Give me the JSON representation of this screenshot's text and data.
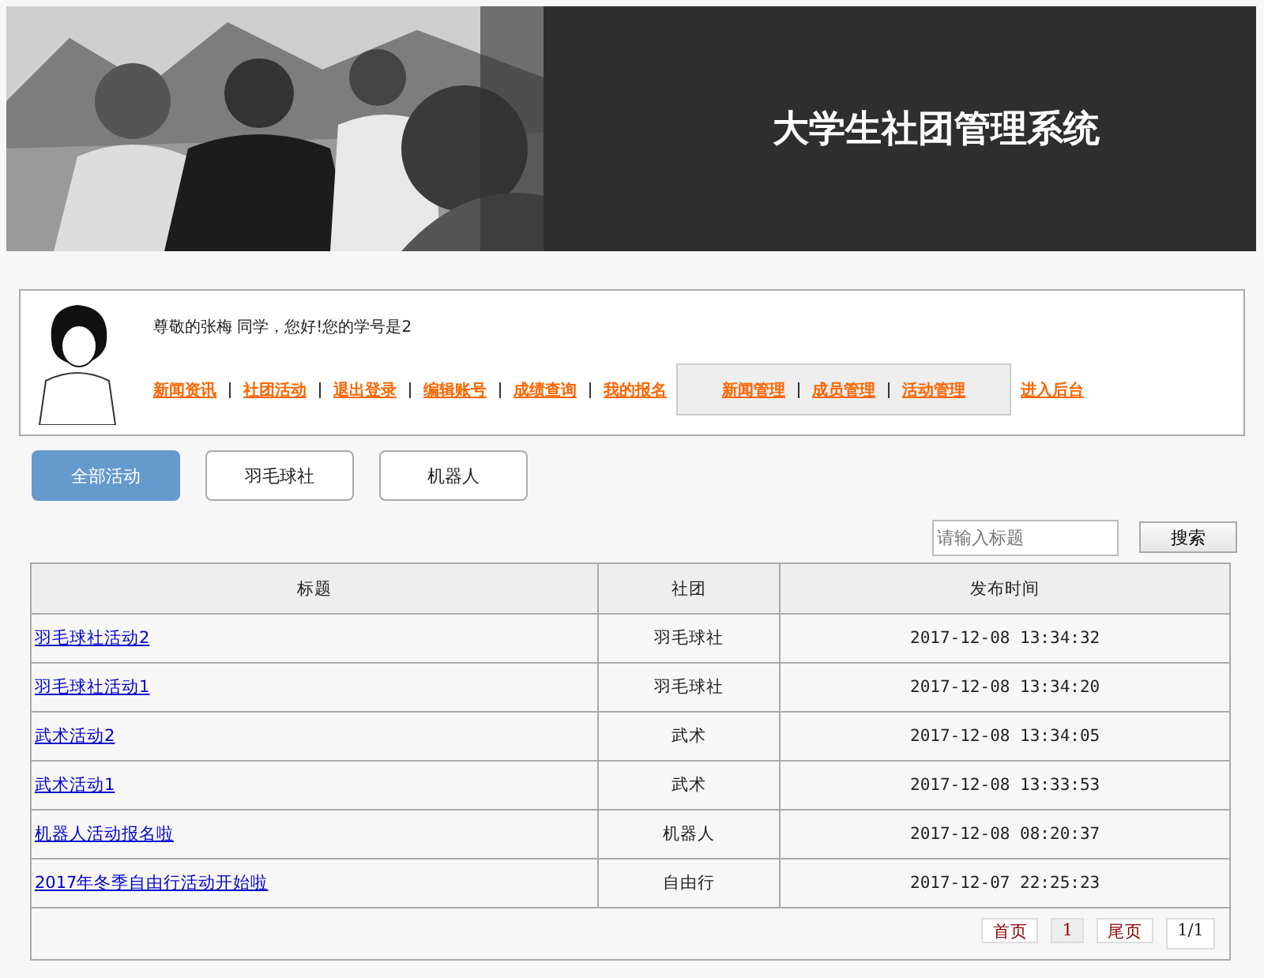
{
  "banner": {
    "title": "大学生社团管理系统"
  },
  "user_panel": {
    "greeting": "尊敬的张梅  同学，您好!您的学号是2",
    "links": [
      "新闻资讯",
      "社团活动",
      "退出登录",
      "编辑账号",
      "成绩查询",
      "我的报名"
    ],
    "admin_links": [
      "新闻管理",
      "成员管理",
      "活动管理"
    ],
    "backend_link": "进入后台"
  },
  "tabs": [
    {
      "label": "全部活动",
      "selected": true
    },
    {
      "label": "羽毛球社",
      "selected": false
    },
    {
      "label": "机器人",
      "selected": false
    }
  ],
  "search": {
    "placeholder": "请输入标题",
    "button": "搜索"
  },
  "table": {
    "columns": [
      "标题",
      "社团",
      "发布时间"
    ],
    "rows": [
      {
        "title": "羽毛球社活动2",
        "club": "羽毛球社",
        "time": "2017-12-08 13:34:32"
      },
      {
        "title": "羽毛球社活动1",
        "club": "羽毛球社",
        "time": "2017-12-08 13:34:20"
      },
      {
        "title": "武术活动2",
        "club": "武术",
        "time": "2017-12-08 13:34:05"
      },
      {
        "title": "武术活动1",
        "club": "武术",
        "time": "2017-12-08 13:33:53"
      },
      {
        "title": "机器人活动报名啦",
        "club": "机器人",
        "time": "2017-12-08 08:20:37"
      },
      {
        "title": "2017年冬季自由行活动开始啦",
        "club": "自由行",
        "time": "2017-12-07 22:25:23"
      }
    ]
  },
  "pagination": {
    "first": "首页",
    "pages": [
      {
        "label": "1",
        "selected": true
      }
    ],
    "last": "尾页",
    "info": "1/1"
  }
}
